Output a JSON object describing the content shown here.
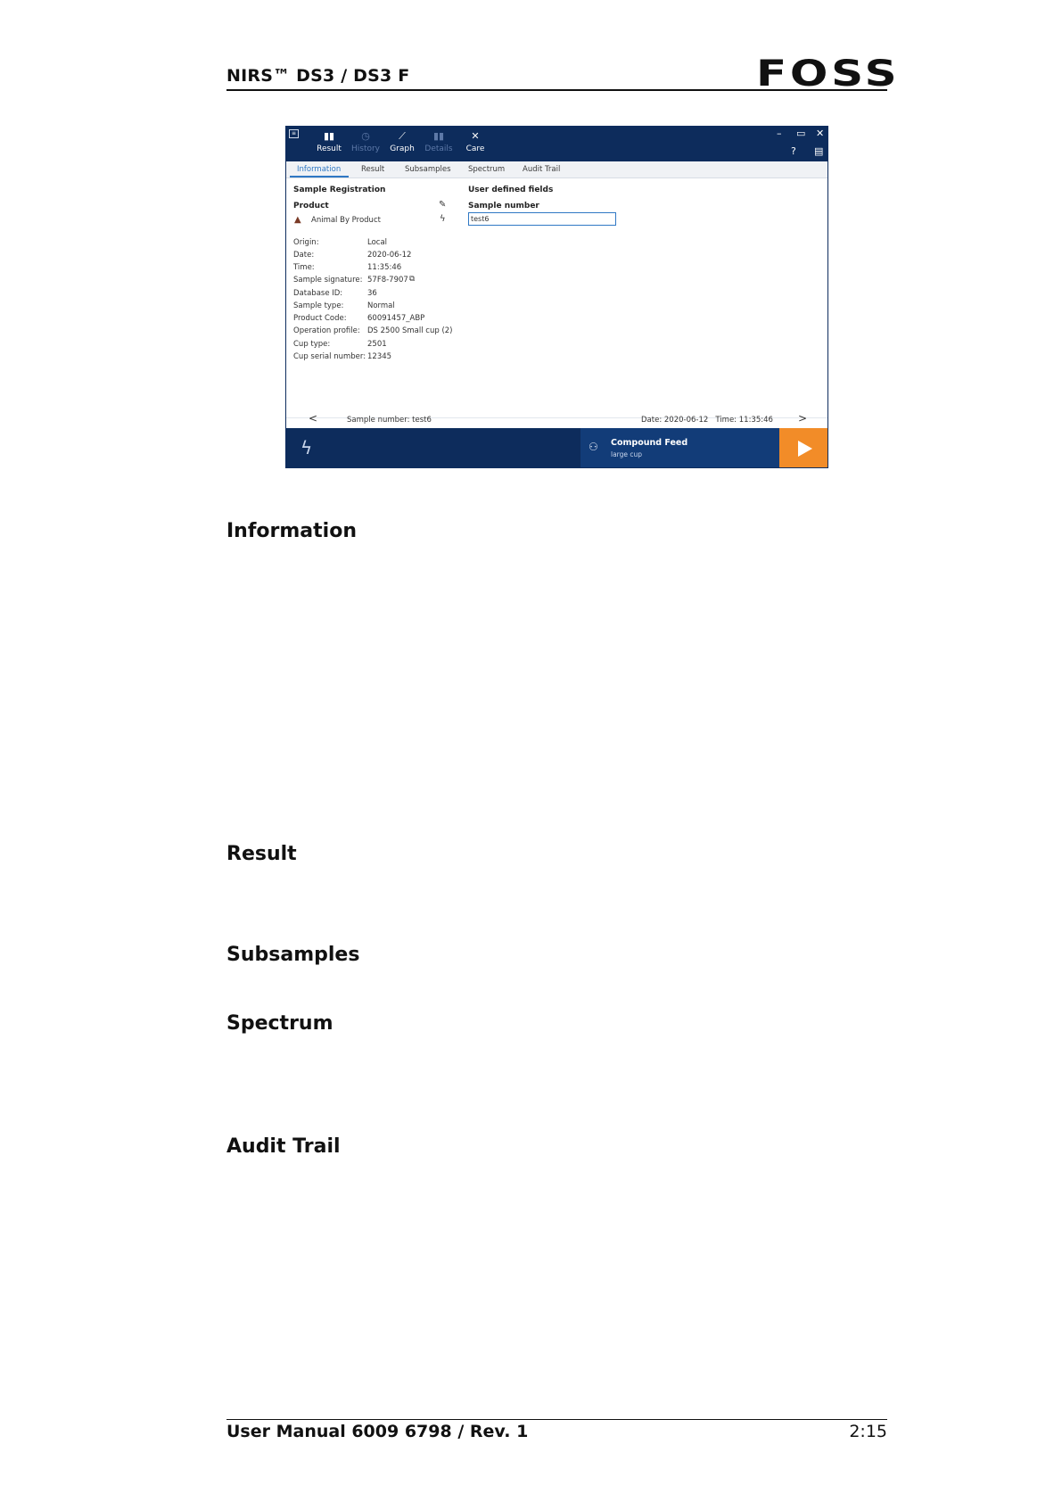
{
  "header": {
    "title": "NIRS™ DS3 / DS3 F",
    "logo": "FOSS"
  },
  "app": {
    "nav": [
      {
        "label": "Result",
        "icon": "bar-chart-icon",
        "enabled": true
      },
      {
        "label": "History",
        "icon": "history-icon",
        "enabled": false
      },
      {
        "label": "Graph",
        "icon": "graph-icon",
        "enabled": true
      },
      {
        "label": "Details",
        "icon": "details-icon",
        "enabled": false
      },
      {
        "label": "Care",
        "icon": "tools-icon",
        "enabled": true
      }
    ],
    "window_controls": {
      "minimize": "–",
      "maximize": "▭",
      "close": "✕"
    },
    "help": "?",
    "tabs": [
      "Information",
      "Result",
      "Subsamples",
      "Spectrum",
      "Audit Trail"
    ],
    "active_tab": "Information",
    "sample_registration": {
      "heading": "Sample Registration",
      "product_label": "Product",
      "product_value": "Animal By Product"
    },
    "details": [
      {
        "key": "Origin:",
        "value": "Local"
      },
      {
        "key": "Date:",
        "value": "2020-06-12"
      },
      {
        "key": "Time:",
        "value": "11:35:46"
      },
      {
        "key": "Sample signature:",
        "value": "57F8-7907"
      },
      {
        "key": "Database ID:",
        "value": "36"
      },
      {
        "key": "Sample type:",
        "value": "Normal"
      },
      {
        "key": "Product Code:",
        "value": "60091457_ABP"
      },
      {
        "key": "Operation profile:",
        "value": "DS 2500 Small cup (2)"
      },
      {
        "key": "Cup type:",
        "value": "2501"
      },
      {
        "key": "Cup serial number:",
        "value": "12345"
      }
    ],
    "user_fields": {
      "heading": "User defined fields",
      "sample_number_label": "Sample number",
      "sample_number_value": "test6"
    },
    "status": {
      "prev": "<",
      "next": ">",
      "sample_number": "Sample number: test6",
      "date_time": "Date: 2020-06-12   Time: 11:35:46"
    },
    "bottom": {
      "product_title": "Compound Feed",
      "product_sub": "large cup",
      "accent": "#f28c28"
    }
  },
  "sections": [
    "Information",
    "Result",
    "Subsamples",
    "Spectrum",
    "Audit Trail"
  ],
  "footer": {
    "left": "User Manual 6009 6798 / Rev. 1",
    "right": "2:15"
  }
}
